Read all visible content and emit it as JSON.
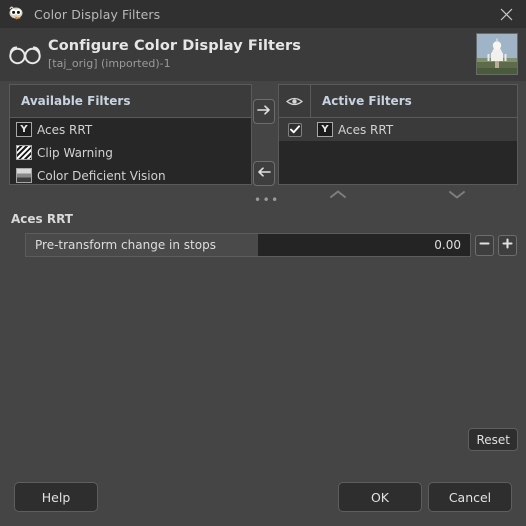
{
  "window": {
    "title": "Color Display Filters",
    "app_icon": "gimp-wilber-icon",
    "close_icon": "close-icon"
  },
  "header": {
    "icon": "glasses-icon",
    "title": "Configure Color Display Filters",
    "subtitle": "[taj_orig] (imported)-1",
    "thumbnail": "image-thumbnail"
  },
  "available_filters": {
    "header": "Available Filters",
    "items": [
      {
        "label": "Aces RRT",
        "icon": "aces-rrt-icon"
      },
      {
        "label": "Clip Warning",
        "icon": "clip-warning-icon"
      },
      {
        "label": "Color Deficient Vision",
        "icon": "color-deficient-vision-icon"
      }
    ]
  },
  "active_filters": {
    "header": "Active Filters",
    "eye_icon": "eye-icon",
    "items": [
      {
        "label": "Aces RRT",
        "icon": "aces-rrt-icon",
        "checked": true,
        "selected": true
      }
    ]
  },
  "transfer": {
    "add_icon": "arrow-right-icon",
    "remove_icon": "arrow-left-icon",
    "more_label": "•••"
  },
  "reorder": {
    "up_icon": "chevron-up-icon",
    "down_icon": "chevron-down-icon"
  },
  "parameters": {
    "title": "Aces RRT",
    "slider": {
      "label": "Pre-transform change in stops",
      "value": "0.00",
      "fill_percent": 46
    },
    "decrement_icon": "minus-icon",
    "increment_icon": "plus-icon"
  },
  "reset": {
    "label": "Reset"
  },
  "footer": {
    "help_label": "Help",
    "ok_label": "OK",
    "cancel_label": "Cancel"
  },
  "colors": {
    "titlebar_bg": "#303030",
    "header_bg": "#3b3b3b",
    "dialog_bg": "#454545",
    "list_bg": "#272727",
    "accent_text": "#c7d3e0",
    "selected_row": "#3a3a3a"
  }
}
